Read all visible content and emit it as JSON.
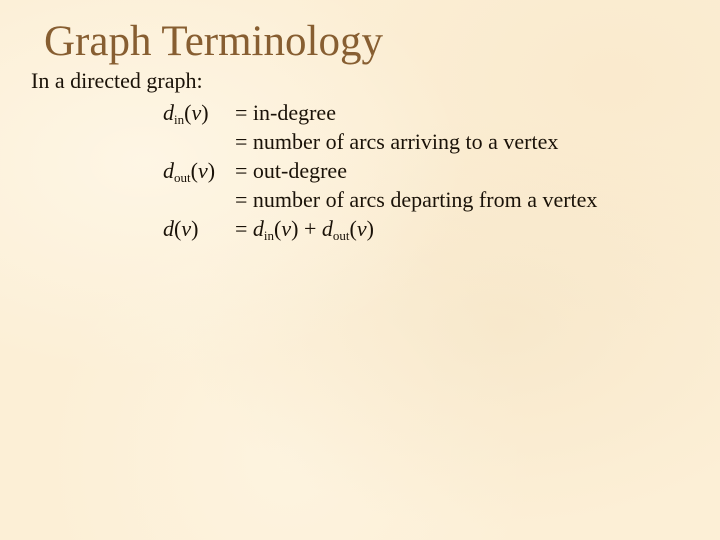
{
  "slide": {
    "title": "Graph Terminology",
    "intro": "In a directed graph:",
    "definitions": [
      {
        "symbol_base": "d",
        "symbol_sub": "in",
        "symbol_arg": "v",
        "rhs": "= in-degree"
      },
      {
        "rhs": "= number of arcs arriving to a vertex"
      },
      {
        "symbol_base": "d",
        "symbol_sub": "out",
        "symbol_arg": "v",
        "rhs": "= out-degree"
      },
      {
        "rhs": "= number of arcs departing from a vertex"
      },
      {
        "symbol_base": "d",
        "symbol_arg": "v",
        "rhs_parts": {
          "eq": "= ",
          "a_base": "d",
          "a_sub": "in",
          "a_arg": "v",
          "plus": " + ",
          "b_base": "d",
          "b_sub": "out",
          "b_arg": "v"
        }
      }
    ],
    "colors": {
      "title": "#875e31",
      "text": "#1a1208",
      "background": "#fcefd6"
    }
  }
}
